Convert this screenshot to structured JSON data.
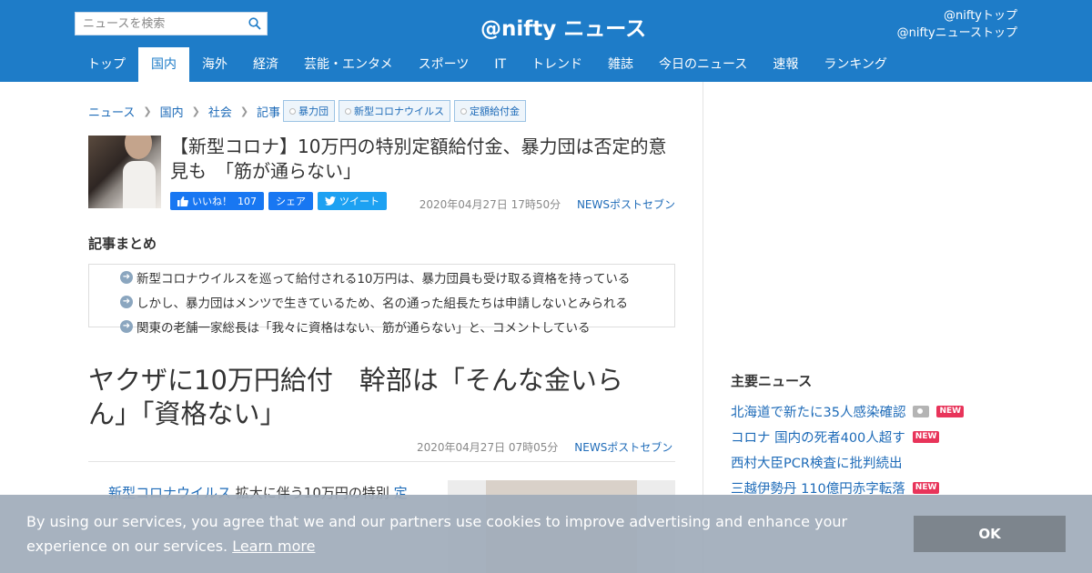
{
  "header": {
    "search_placeholder": "ニュースを検索",
    "logo": "@nifty ニュース",
    "links": [
      "@niftyトップ",
      "@niftyニューストップ"
    ],
    "nav": [
      "トップ",
      "国内",
      "海外",
      "経済",
      "芸能・エンタメ",
      "スポーツ",
      "IT",
      "トレンド",
      "雑誌",
      "今日のニュース",
      "速報",
      "ランキング"
    ],
    "active_tab": "国内"
  },
  "breadcrumb": [
    "ニュース",
    "国内",
    "社会",
    "記事"
  ],
  "tags": [
    "暴力団",
    "新型コロナウイルス",
    "定額給付金"
  ],
  "article": {
    "headline": "【新型コロナ】10万円の特別定額給付金、暴力団は否定的意見も　「筋が通らない」",
    "like_label": "いいね！",
    "like_count": "107",
    "share_label": "シェア",
    "tweet_label": "ツイート",
    "date": "2020年04月27日 17時50分",
    "source": "NEWSポストセブン"
  },
  "summary": {
    "title": "記事まとめ",
    "items": [
      "新型コロナウイルスを巡って給付される10万円は、暴力団員も受け取る資格を持っている",
      "しかし、暴力団はメンツで生きているため、名の通った組長たちは申請しないとみられる",
      "関東の老舗一家総長は「我々に資格はない、筋が通らない」と、コメントしている"
    ]
  },
  "story": {
    "title": "ヤクザに10万円給付　幹部は「そんな金いらん」「資格ない」",
    "date": "2020年04月27日 07時05分",
    "source": "NEWSポストセブン",
    "body_link": "新型コロナウイルス",
    "body_text": "拡大に伴う10万円の特別",
    "body_link2": "定"
  },
  "sidebar": {
    "title": "主要ニュース",
    "items": [
      {
        "text": "北海道で新たに35人感染確認",
        "camera": true,
        "badge": "NEW"
      },
      {
        "text": "コロナ 国内の死者400人超す",
        "camera": false,
        "badge": "NEW"
      },
      {
        "text": "西村大臣PCR検査に批判続出",
        "camera": false,
        "badge": ""
      },
      {
        "text": "三越伊勢丹 110億円赤字転落",
        "camera": false,
        "badge": "NEW"
      }
    ]
  },
  "cookie": {
    "message": "By using our services, you agree that we and our partners use cookies to improve advertising and enhance your experience on our services.",
    "learn_more": "Learn more",
    "ok": "OK"
  },
  "colors": {
    "header_bg": "#1e7cc8",
    "link": "#1e6bb8",
    "new_badge": "#e8345a",
    "cookie_bg": "#a0acba"
  }
}
